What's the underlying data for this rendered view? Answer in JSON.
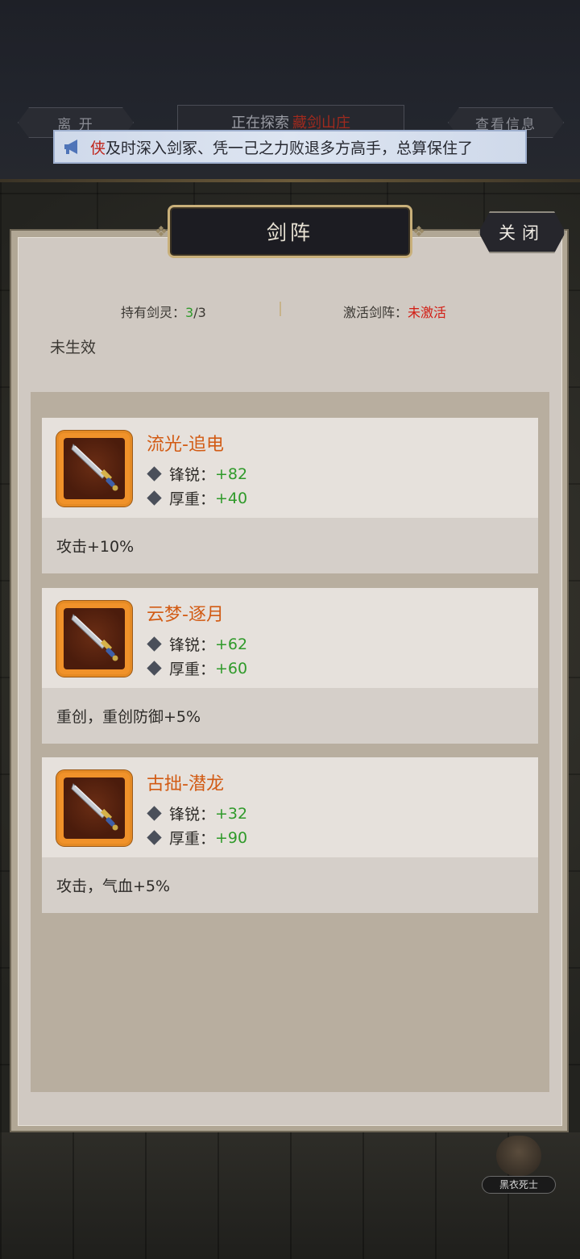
{
  "top_bar": {
    "leave_label": "离 开",
    "explore_prefix": "正在探索",
    "explore_place": "藏剑山庄",
    "info_label": "查看信息"
  },
  "banner": {
    "speaker": "侠",
    "message": "及时深入剑冢、凭一己之力败退多方高手，总算保住了"
  },
  "panel": {
    "title": "剑阵",
    "close_label": "关闭",
    "held_label": "持有剑灵：",
    "held_count": "3",
    "held_total": "/3",
    "activate_label": "激活剑阵：",
    "activate_value": "未激活",
    "effect_status": "未生效"
  },
  "cards": [
    {
      "name": "流光-追电",
      "attrs": [
        {
          "label": "锋锐：",
          "value": "+82"
        },
        {
          "label": "厚重：",
          "value": "+40"
        }
      ],
      "effect": "攻击+10%"
    },
    {
      "name": "云梦-逐月",
      "attrs": [
        {
          "label": "锋锐：",
          "value": "+62"
        },
        {
          "label": "厚重：",
          "value": "+60"
        }
      ],
      "effect": "重创，重创防御+5%"
    },
    {
      "name": "古拙-潜龙",
      "attrs": [
        {
          "label": "锋锐：",
          "value": "+32"
        },
        {
          "label": "厚重：",
          "value": "+90"
        }
      ],
      "effect": "攻击，气血+5%"
    }
  ],
  "npc": {
    "label": "黑衣死士"
  },
  "colors": {
    "item_name": "#d25b14",
    "attr_value": "#2f9a2a",
    "inactive": "#d21c13",
    "icon_frame": "#f0922a"
  },
  "icons": {
    "banner": "megaphone-icon",
    "item": "sword-icon",
    "attr": "diamond-icon"
  }
}
